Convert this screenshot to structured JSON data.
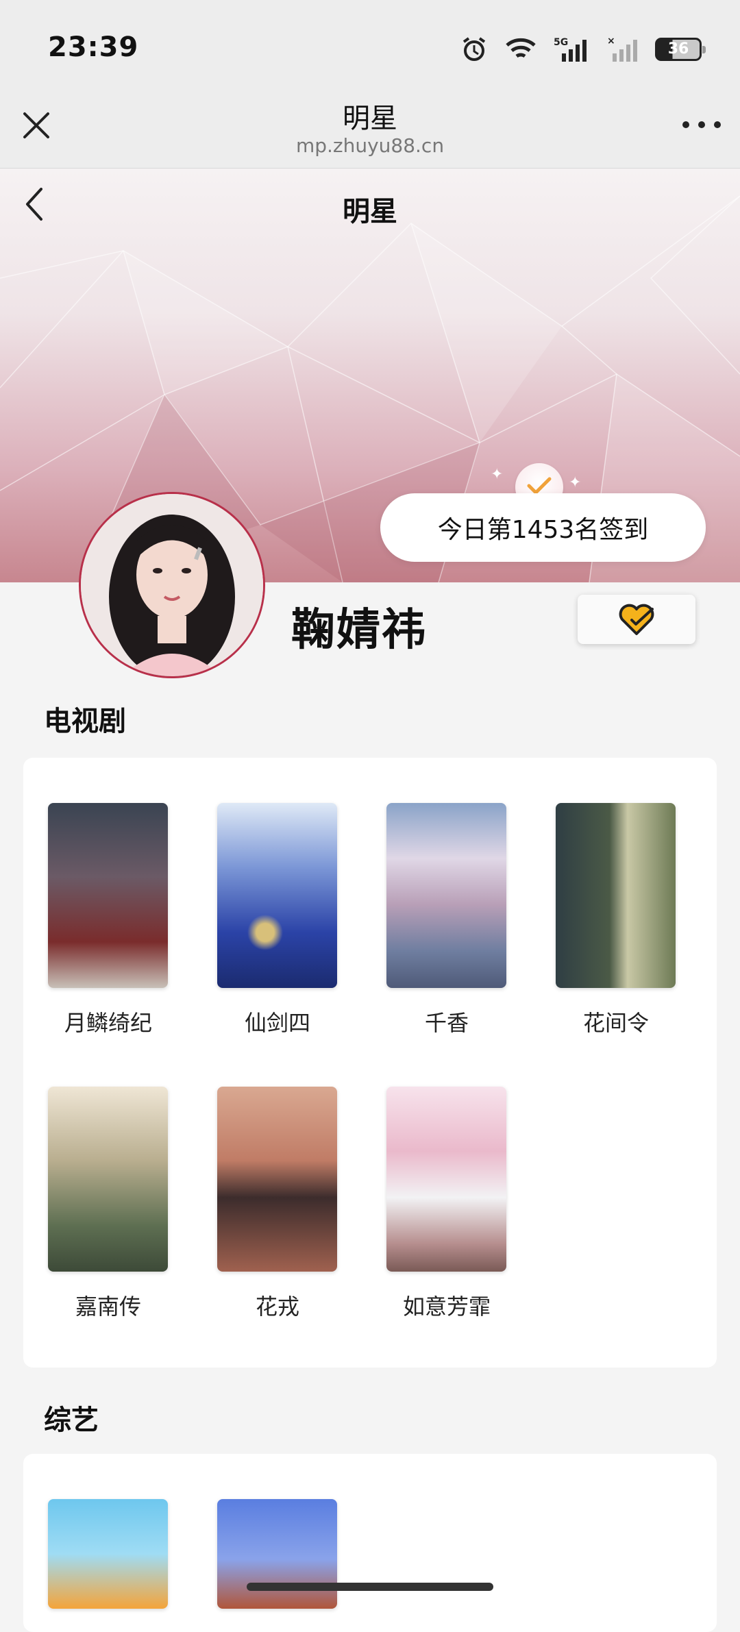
{
  "status": {
    "time": "23:39",
    "network": "5G",
    "battery": "36"
  },
  "browser": {
    "title": "明星",
    "url": "mp.zhuyu88.cn"
  },
  "hero": {
    "title": "明星",
    "checkin_text": "今日第1453名签到"
  },
  "profile": {
    "name": "鞠婧祎"
  },
  "tv_section": {
    "title": "电视剧",
    "items": [
      "月鳞绮纪",
      "仙剑四",
      "千香",
      "花间令",
      "嘉南传",
      "花戎",
      "如意芳霏"
    ]
  },
  "variety_section": {
    "title": "综艺"
  },
  "colors": {
    "accent": "#b8304a",
    "hero_pink": "#c7868f",
    "check_orange": "#f0a23a"
  }
}
